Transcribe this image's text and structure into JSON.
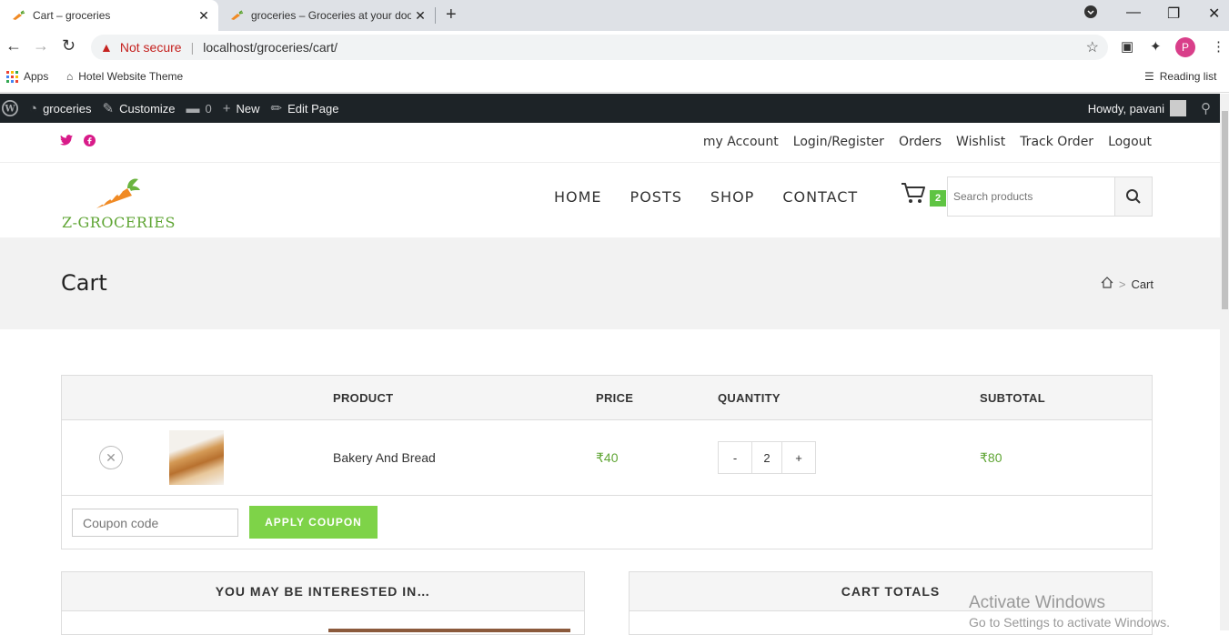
{
  "browser": {
    "tabs": [
      {
        "title": "Cart – groceries",
        "active": true
      },
      {
        "title": "groceries – Groceries at your doo",
        "active": false
      }
    ],
    "security_label": "Not secure",
    "url": "localhost/groceries/cart/",
    "bookmarks": [
      {
        "label": "Apps",
        "icon": "apps-grid-icon"
      },
      {
        "label": "Hotel Website Theme",
        "icon": "hotel-icon"
      }
    ],
    "reading_list": "Reading list",
    "profile_initial": "P"
  },
  "admin_bar": {
    "site_name": "groceries",
    "customize": "Customize",
    "comments_count": "0",
    "new_label": "New",
    "edit_page": "Edit Page",
    "howdy": "Howdy, pavani"
  },
  "top_links": [
    "my Account",
    "Login/Register",
    "Orders",
    "Wishlist",
    "Track Order",
    "Logout"
  ],
  "logo_text": "Z-GROCERIES",
  "main_nav": [
    "HOME",
    "POSTS",
    "SHOP",
    "CONTACT"
  ],
  "cart_count": "2",
  "search": {
    "placeholder": "Search products"
  },
  "page": {
    "title": "Cart",
    "breadcrumb_current": "Cart"
  },
  "cart": {
    "headers": {
      "product": "PRODUCT",
      "price": "PRICE",
      "quantity": "QUANTITY",
      "subtotal": "SUBTOTAL"
    },
    "items": [
      {
        "name": "Bakery And Bread",
        "price": "₹40",
        "quantity": "2",
        "subtotal": "₹80"
      }
    ],
    "qty_minus": "-",
    "qty_plus": "+",
    "coupon_placeholder": "Coupon code",
    "apply_coupon": "APPLY COUPON"
  },
  "panels": {
    "interested": "YOU MAY BE INTERESTED IN…",
    "totals": "CART TOTALS"
  },
  "watermark": {
    "line1": "Activate Windows",
    "line2": "Go to Settings to activate Windows."
  },
  "colors": {
    "accent_green": "#5fa534",
    "button_green": "#7ed348",
    "badge_green": "#5fc443",
    "social_pink": "#d81b89",
    "admin_bar": "#1d2327"
  }
}
